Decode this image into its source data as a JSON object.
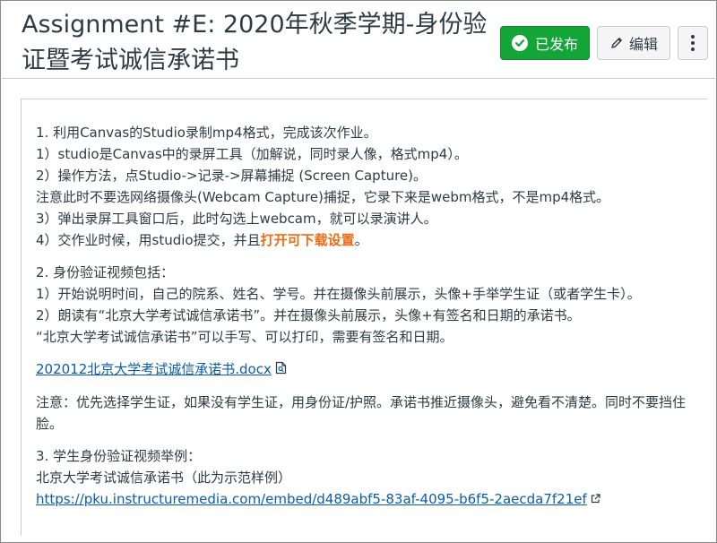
{
  "page": {
    "title": "Assignment #E: 2020年秋季学期-身份验证暨考试诚信承诺书"
  },
  "header_buttons": {
    "published_label": "已发布",
    "edit_label": "编辑",
    "more_icon": "kebab-icon"
  },
  "colors": {
    "published_bg": "#13a538",
    "link": "#0b5cad",
    "highlight": "#f06b15",
    "text": "#2d3b45"
  },
  "content": {
    "section1": {
      "heading": "1. 利用Canvas的Studio录制mp4格式，完成该次作业。",
      "line1": "1）studio是Canvas中的录屏工具（加解说，同时录人像，格式mp4）。",
      "line2": "2）操作方法，点Studio->记录->屏幕捕捉 (Screen Capture)。",
      "line3": "注意此时不要选网络摄像头(Webcam Capture)捕捉，它录下来是webm格式，不是mp4格式。",
      "line4": "3）弹出录屏工具窗口后，此时勾选上webcam，就可以录演讲人。",
      "line5_prefix": "4）交作业时候，用studio提交，并且",
      "line5_highlight": "打开可下载设置",
      "line5_suffix": "。"
    },
    "section2": {
      "heading": "2. 身份验证视频包括：",
      "line1": "1）开始说明时间，自己的院系、姓名、学号。并在摄像头前展示，头像+手举学生证（或者学生卡）。",
      "line2": "2）朗读有“北京大学考试诚信承诺书”。并在摄像头前展示，头像+有签名和日期的承诺书。",
      "line3": "“北京大学考试诚信承诺书”可以手写、可以打印，需要有签名和日期。"
    },
    "attachment": {
      "filename": "202012北京大学考试诚信承诺书.docx",
      "icon": "document-preview-icon"
    },
    "note": "注意：优先选择学生证，如果没有学生证，用身份证/护照。承诺书推近摄像头，避免看不清楚。同时不要挡住脸。",
    "section3": {
      "heading": "3. 学生身份验证视频举例：",
      "line1": "北京大学考试诚信承诺书（此为示范样例）",
      "url": "https://pku.instructuremedia.com/embed/d489abf5-83af-4095-b6f5-2aecda7f21ef",
      "url_icon": "external-link-icon"
    }
  }
}
